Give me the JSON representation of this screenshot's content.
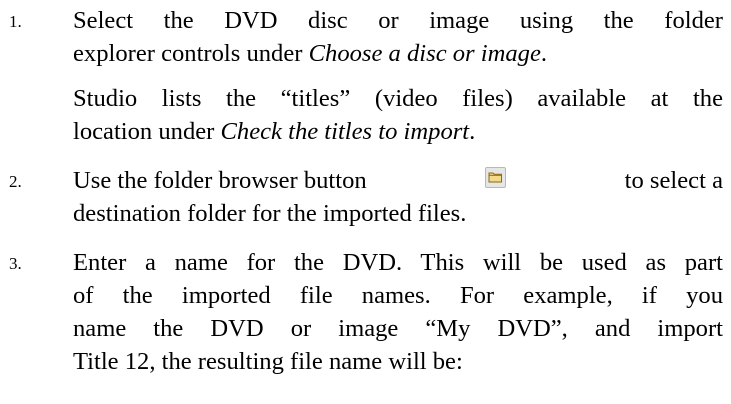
{
  "steps": [
    {
      "number": "1.",
      "lines": [
        {
          "a": "Select the DVD disc or image using the folder"
        },
        {
          "a": "explorer controls under ",
          "i": "Choose a disc or image",
          "b": "."
        }
      ],
      "note_lines": [
        {
          "a": "Studio lists the “titles” (video files) available at the"
        },
        {
          "a": "location under ",
          "i": "Check the titles to import",
          "b": "."
        }
      ]
    },
    {
      "number": "2.",
      "line1_before": "Use the folder browser button",
      "line1_after": "to select a",
      "line2": "destination folder for the imported files.",
      "button_icon": "folder-icon"
    },
    {
      "number": "3.",
      "lines": [
        {
          "a": "Enter a name for the DVD. This will be used as part"
        },
        {
          "a": "of the imported file names. For example, if you"
        },
        {
          "a": "name the DVD or image “My DVD”, and import"
        },
        {
          "a": "Title 12, the resulting file name will be:"
        }
      ]
    }
  ]
}
